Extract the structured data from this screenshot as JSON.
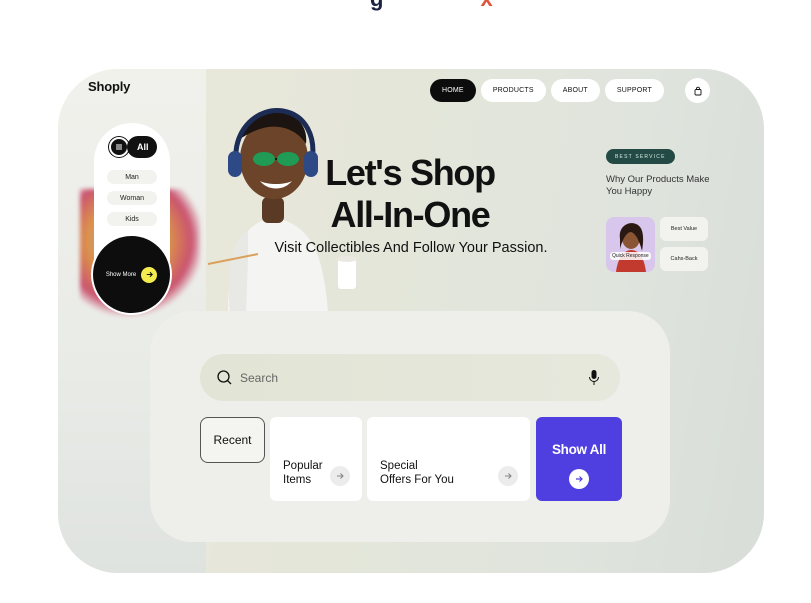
{
  "app": {
    "logo": "Shoply"
  },
  "nav": {
    "items": [
      {
        "label": "HOME",
        "active": true
      },
      {
        "label": "PRODUCTS",
        "active": false
      },
      {
        "label": "ABOUT",
        "active": false
      },
      {
        "label": "SUPPORT",
        "active": false
      }
    ],
    "cart_icon": "shopping-bag-icon"
  },
  "sidebar": {
    "all_label": "All",
    "menu_icon": "menu-icon",
    "categories": [
      "Man",
      "Woman",
      "Kids"
    ],
    "show_more_label": "Show More",
    "show_more_icon": "arrow-right-icon"
  },
  "hero": {
    "headline_line1": "Let's Shop",
    "headline_line2": "All-In-One",
    "subline": "Visit Collectibles And Follow Your Passion."
  },
  "service": {
    "badge": "BEST SERVICE",
    "heading": "Why Our Products Make You Happy",
    "card_label": "Quick Response",
    "chips": [
      "Best Value",
      "Cahs-Back"
    ]
  },
  "search": {
    "placeholder": "Search",
    "value": "",
    "mic_icon": "microphone-icon"
  },
  "quick_options": {
    "recent": "Recent",
    "popular_line1": "Popular",
    "popular_line2": "Items",
    "special_line1": "Special",
    "special_line2": "Offers For You",
    "show_all": "Show All"
  },
  "colors": {
    "accent": "#4f3fe0",
    "badge_bg": "#244a45",
    "show_more_arrow": "#f4ec4e",
    "dark": "#0c0c0c"
  }
}
